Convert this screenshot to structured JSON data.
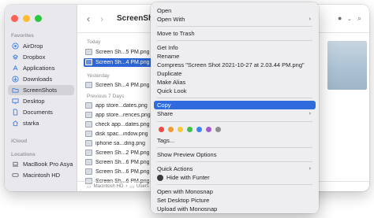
{
  "sidebar": {
    "favorites_header": "Favorites",
    "icloud_header": "iCloud",
    "locations_header": "Locations",
    "items": [
      {
        "label": "AirDrop",
        "icon": "airdrop-icon"
      },
      {
        "label": "Dropbox",
        "icon": "dropbox-icon"
      },
      {
        "label": "Applications",
        "icon": "applications-icon"
      },
      {
        "label": "Downloads",
        "icon": "downloads-icon"
      },
      {
        "label": "ScreenShots",
        "icon": "folder-icon",
        "selected": true
      },
      {
        "label": "Desktop",
        "icon": "desktop-icon"
      },
      {
        "label": "Documents",
        "icon": "document-icon"
      },
      {
        "label": "starka",
        "icon": "home-icon"
      }
    ],
    "locations": [
      {
        "label": "MacBook Pro Asya",
        "icon": "laptop-icon"
      },
      {
        "label": "Macintosh HD",
        "icon": "disk-icon"
      }
    ]
  },
  "toolbar": {
    "back": "‹",
    "forward": "›",
    "title": "ScreenShots"
  },
  "list": {
    "groups": {
      "today": "Today",
      "yesterday": "Yesterday",
      "previous": "Previous 7 Days"
    },
    "files": [
      {
        "name": "Screen Sh...5 PM.png"
      },
      {
        "name": "Screen Sh...4 PM.png",
        "selected": true
      },
      {
        "name": "Screen Sh...4 PM.png"
      },
      {
        "name": "app store...dates.png"
      },
      {
        "name": "app store...rences.png"
      },
      {
        "name": "check app...dates.png"
      },
      {
        "name": "disk spac...indow.png"
      },
      {
        "name": "iphone sa...ding.png"
      },
      {
        "name": "Screen Sh...2 PM.png"
      },
      {
        "name": "Screen Sh...6 PM.png"
      },
      {
        "name": "Screen Sh...6 PM.png"
      },
      {
        "name": "Screen Sh...6 PM.png"
      }
    ]
  },
  "pathbar": {
    "disk": "Macintosh HD",
    "users": "Users"
  },
  "context_menu": {
    "items": [
      {
        "label": "Open"
      },
      {
        "label": "Open With",
        "submenu": true
      },
      {
        "label": "Move to Trash"
      },
      {
        "label": "Get Info"
      },
      {
        "label": "Rename"
      },
      {
        "label": "Compress \"Screen Shot 2021-10-27 at 2.03.44 PM.png\""
      },
      {
        "label": "Duplicate"
      },
      {
        "label": "Make Alias"
      },
      {
        "label": "Quick Look"
      },
      {
        "label": "Copy",
        "highlighted": true
      },
      {
        "label": "Share",
        "submenu": true
      },
      {
        "label": "Tags..."
      },
      {
        "label": "Show Preview Options"
      },
      {
        "label": "Quick Actions",
        "submenu": true
      },
      {
        "label": "Hide with Funter"
      },
      {
        "label": "Open with Monosnap"
      },
      {
        "label": "Set Desktop Picture"
      },
      {
        "label": "Upload with Monosnap"
      }
    ],
    "tag_colors": [
      "#f04a43",
      "#f59a31",
      "#f5c93a",
      "#3fc24b",
      "#3a85f2",
      "#a35bd3",
      "#8e8e93"
    ]
  }
}
